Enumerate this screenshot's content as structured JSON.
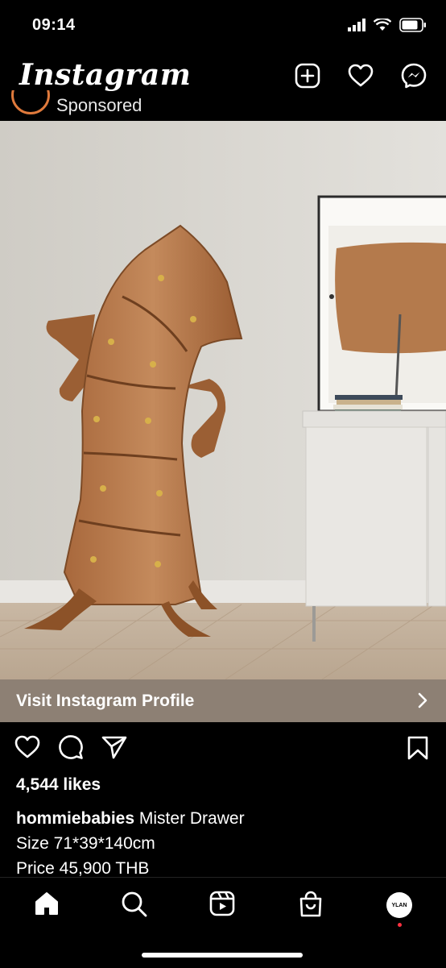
{
  "status_bar": {
    "time": "09:14"
  },
  "app": {
    "title": "Instagram"
  },
  "post": {
    "sponsored_label": "Sponsored",
    "visit_profile_label": "Visit Instagram Profile",
    "likes_text": "4,544 likes",
    "caption": {
      "username": "hommiebabies",
      "line1": "Mister Drawer",
      "line2": "Size 71*39*140cm",
      "line3": "Price 45,900 THB"
    }
  },
  "tab_bar": {
    "profile_avatar_text": "YLAN"
  },
  "colors": {
    "background": "#000000",
    "visit_bar": "#8d8074",
    "notification_dot": "#ff3040",
    "sponsored_ring": "#e07a3c"
  },
  "icons": [
    "signal-icon",
    "wifi-icon",
    "battery-icon",
    "new-post-icon",
    "heart-icon",
    "messenger-icon",
    "like-icon",
    "comment-icon",
    "share-icon",
    "save-icon",
    "home-icon",
    "search-icon",
    "reels-icon",
    "shop-icon",
    "chevron-right-icon"
  ]
}
